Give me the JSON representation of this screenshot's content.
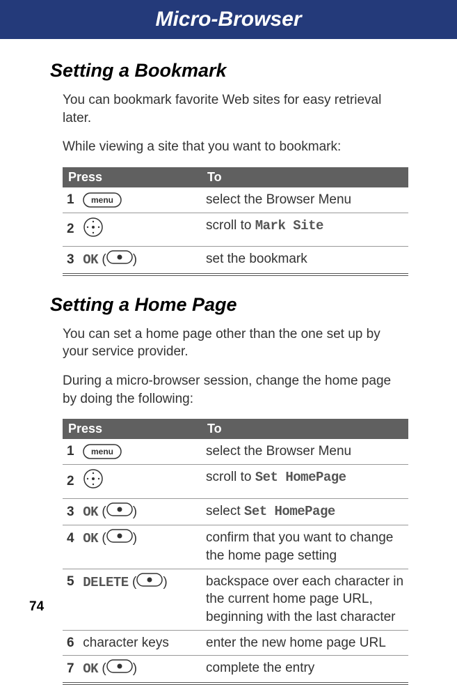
{
  "header": {
    "title": "Micro-Browser"
  },
  "page_number": "74",
  "columns": {
    "press": "Press",
    "to": "To"
  },
  "keys": {
    "menu": "menu",
    "ok": "OK",
    "delete": "DELETE"
  },
  "section1": {
    "title": "Setting a Bookmark",
    "p1": "You can bookmark favorite Web sites for easy retrieval later.",
    "p2": "While viewing a site that you want to bookmark:",
    "rows": [
      {
        "n": "1",
        "press_type": "menu",
        "to": "select the Browser Menu"
      },
      {
        "n": "2",
        "press_type": "nav",
        "to_pre": "scroll to ",
        "to_key": "Mark Site"
      },
      {
        "n": "3",
        "press_type": "ok",
        "to": "set the bookmark"
      }
    ]
  },
  "section2": {
    "title": "Setting a Home Page",
    "p1": "You can set a home page other than the one set up by your service provider.",
    "p2": "During a micro-browser session, change the home page by doing the following:",
    "rows": [
      {
        "n": "1",
        "press_type": "menu",
        "to": "select the Browser Menu"
      },
      {
        "n": "2",
        "press_type": "nav",
        "to_pre": "scroll to ",
        "to_key": "Set HomePage"
      },
      {
        "n": "3",
        "press_type": "ok",
        "to_pre": "select ",
        "to_key": "Set HomePage"
      },
      {
        "n": "4",
        "press_type": "ok",
        "to": "confirm that you want to change the home page setting"
      },
      {
        "n": "5",
        "press_type": "delete",
        "to": "backspace over each character in the current home page URL, beginning with the last character"
      },
      {
        "n": "6",
        "press_type": "text",
        "press_text": "character keys",
        "to": "enter the new home page URL"
      },
      {
        "n": "7",
        "press_type": "ok",
        "to": "complete the entry"
      }
    ]
  }
}
